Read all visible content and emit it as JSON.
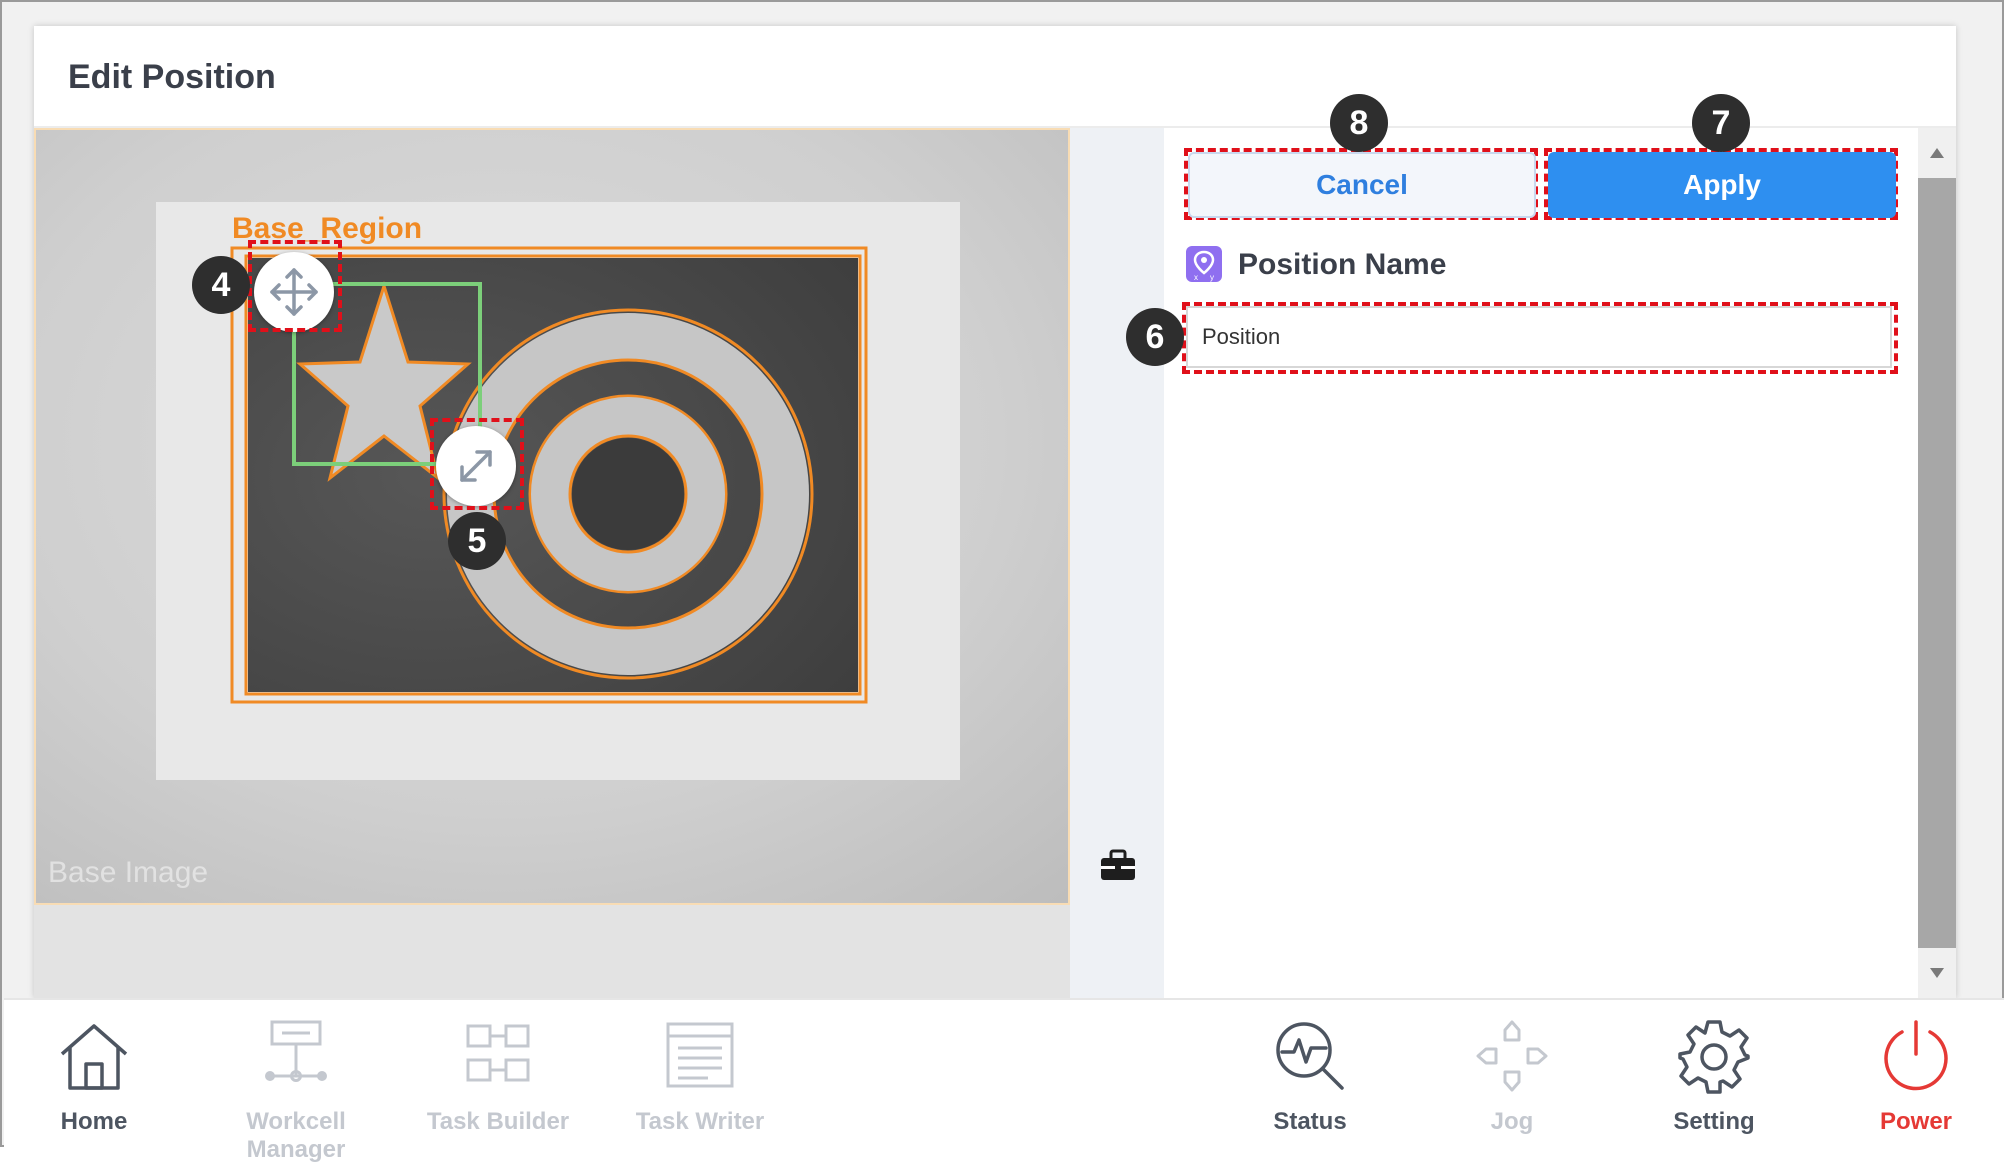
{
  "dialog": {
    "title": "Edit Position"
  },
  "camera": {
    "region_label": "Base_Region",
    "watermark": "Base Image"
  },
  "buttons": {
    "cancel": "Cancel",
    "apply": "Apply"
  },
  "position": {
    "label": "Position Name",
    "value": "Position"
  },
  "badges": {
    "b4": "4",
    "b5": "5",
    "b6": "6",
    "b7": "7",
    "b8": "8"
  },
  "colors": {
    "accent": "#2e8ff0",
    "highlight": "#e0101a",
    "region": "#f08a24",
    "roi": "#7ccf7a",
    "power": "#e53935"
  },
  "nav": {
    "home": "Home",
    "workcell": "Workcell Manager",
    "task_builder": "Task Builder",
    "task_writer": "Task Writer",
    "status": "Status",
    "jog": "Jog",
    "setting": "Setting",
    "power": "Power"
  }
}
